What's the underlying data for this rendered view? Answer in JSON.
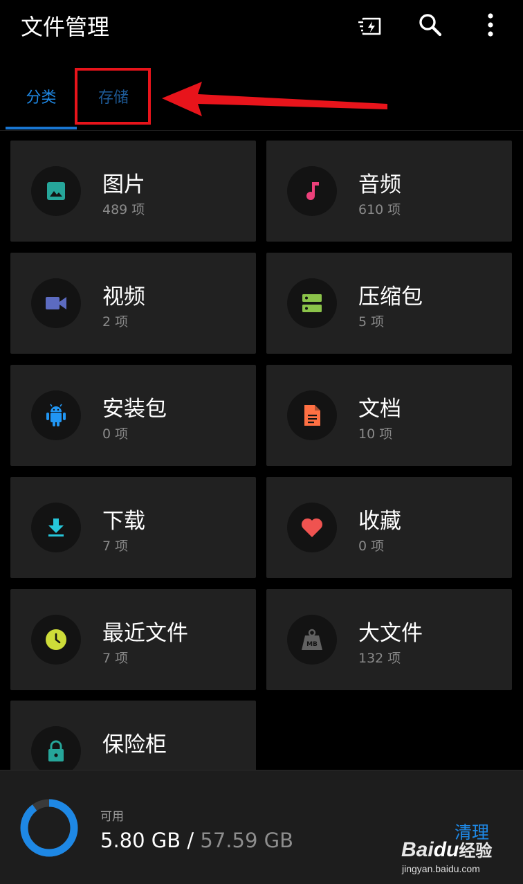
{
  "app": {
    "title": "文件管理"
  },
  "toolbar": {
    "icons": [
      "lightning-file-icon",
      "search-icon",
      "more-vert-icon"
    ]
  },
  "tabs": [
    {
      "label": "分类",
      "selected": true
    },
    {
      "label": "存储",
      "selected": false
    }
  ],
  "annotation": {
    "highlight_color": "#e8141b"
  },
  "categories": [
    {
      "label": "图片",
      "count": "489 项",
      "icon": "image-icon",
      "color": "#26a69a"
    },
    {
      "label": "音频",
      "count": "610 项",
      "icon": "music-note-icon",
      "color": "#ec407a"
    },
    {
      "label": "视频",
      "count": "2 项",
      "icon": "videocam-icon",
      "color": "#5c6bc0"
    },
    {
      "label": "压缩包",
      "count": "5 项",
      "icon": "archive-icon",
      "color": "#8bc34a"
    },
    {
      "label": "安装包",
      "count": "0 项",
      "icon": "android-icon",
      "color": "#2196f3"
    },
    {
      "label": "文档",
      "count": "10 项",
      "icon": "document-icon",
      "color": "#ff7043"
    },
    {
      "label": "下载",
      "count": "7 项",
      "icon": "download-icon",
      "color": "#26c6da"
    },
    {
      "label": "收藏",
      "count": "0 项",
      "icon": "heart-icon",
      "color": "#ef5350"
    },
    {
      "label": "最近文件",
      "count": "7 项",
      "icon": "clock-icon",
      "color": "#cddc39"
    },
    {
      "label": "大文件",
      "count": "132 项",
      "icon": "mb-weight-icon",
      "color": "#616161"
    },
    {
      "label": "保险柜",
      "count": "",
      "icon": "lock-icon",
      "color": "#26a69a"
    }
  ],
  "storage": {
    "label": "可用",
    "used": "5.80 GB",
    "separator": " / ",
    "total": "57.59 GB",
    "available_fraction": 0.1,
    "ring_color": "#1e88e5",
    "clean_label": "清理"
  },
  "watermark": {
    "logo_text": "Bai",
    "logo_paw": "du",
    "logo_cn": "经验",
    "url": "jingyan.baidu.com"
  }
}
